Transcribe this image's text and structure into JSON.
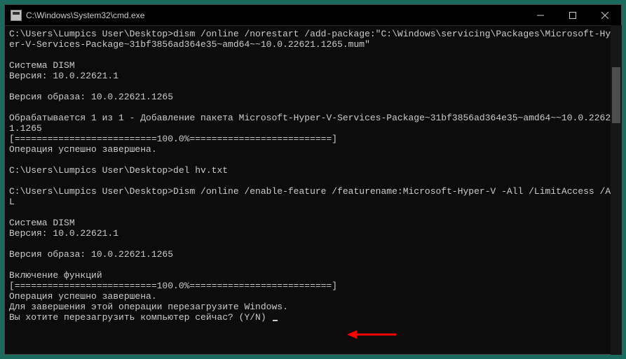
{
  "window": {
    "title": "C:\\Windows\\System32\\cmd.exe"
  },
  "terminal": {
    "lines": [
      "C:\\Users\\Lumpics User\\Desktop>dism /online /norestart /add-package:\"C:\\Windows\\servicing\\Packages\\Microsoft-Hyper-V-Services-Package~31bf3856ad364e35~amd64~~10.0.22621.1265.mum\"",
      "",
      "Cистема DISM",
      "Версия: 10.0.22621.1",
      "",
      "Версия образа: 10.0.22621.1265",
      "",
      "Обрабатывается 1 из 1 - Добавление пакета Microsoft-Hyper-V-Services-Package~31bf3856ad364e35~amd64~~10.0.22621.1265",
      "[==========================100.0%==========================]",
      "Операция успешно завершена.",
      "",
      "C:\\Users\\Lumpics User\\Desktop>del hv.txt",
      "",
      "C:\\Users\\Lumpics User\\Desktop>Dism /online /enable-feature /featurename:Microsoft-Hyper-V -All /LimitAccess /ALL",
      "",
      "Cистема DISM",
      "Версия: 10.0.22621.1",
      "",
      "Версия образа: 10.0.22621.1265",
      "",
      "Включение функций",
      "[==========================100.0%==========================]",
      "Операция успешно завершена.",
      "Для завершения этой операции перезагрузите Windows.",
      "Вы хотите перезагрузить компьютер сейчас? (Y/N) "
    ]
  }
}
